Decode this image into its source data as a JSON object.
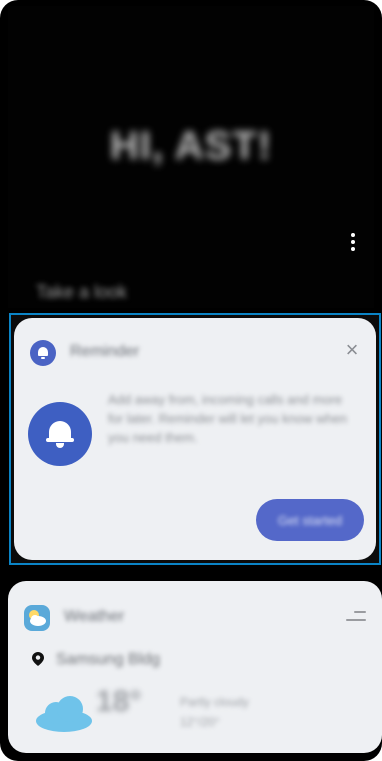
{
  "hero": {
    "greeting": "HI, AST!",
    "subtitle": "Take a look"
  },
  "reminder_card": {
    "app_name": "Reminder",
    "body": "Add away from, incoming calls and more for later. Reminder will let you know when you need them.",
    "cta_label": "Get started",
    "close_symbol": "×"
  },
  "weather_card": {
    "app_name": "Weather",
    "location": "Samsung Bldg",
    "temperature": "18°",
    "detail_line1": "Partly cloudy",
    "detail_line2": "12°/20°"
  },
  "colors": {
    "accent_blue": "#4a63c4",
    "button_blue": "#5468c9",
    "highlight_border": "#0b84c6",
    "card_bg": "#eef0f3",
    "weather_sky": "#5aa9d9"
  },
  "icons": {
    "reminder": "bell-icon",
    "weather": "weather-icon",
    "location": "location-pin-icon",
    "more": "more-vertical-icon",
    "close": "close-icon",
    "handle": "drag-handle-icon",
    "cloud": "cloud-icon"
  }
}
